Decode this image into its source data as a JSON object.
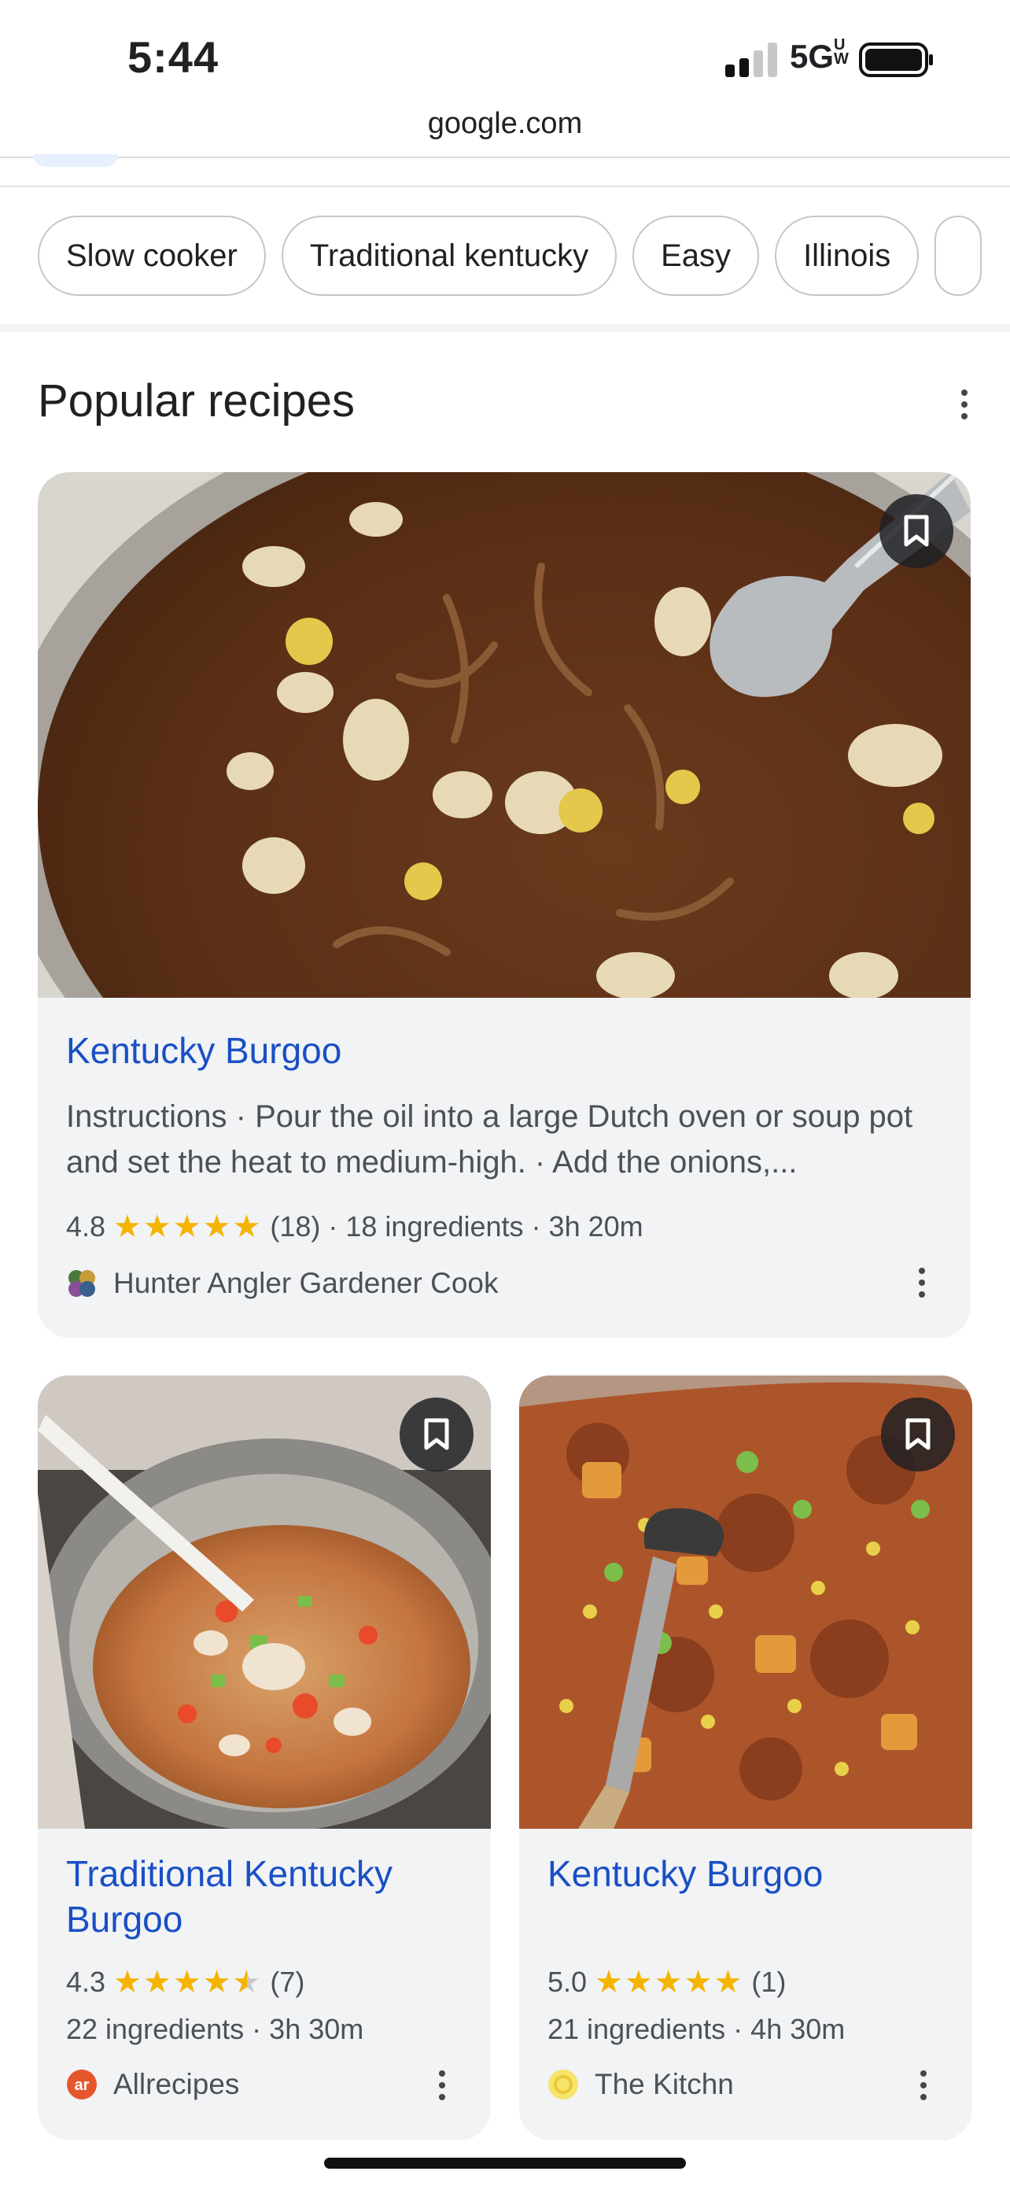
{
  "status_bar": {
    "time": "5:44",
    "network": "5G",
    "network_badge": "UW"
  },
  "browser": {
    "url": "google.com"
  },
  "filter_chips": [
    "Slow cooker",
    "Traditional kentucky",
    "Easy",
    "Illinois"
  ],
  "section": {
    "title": "Popular recipes"
  },
  "recipes": [
    {
      "title": "Kentucky Burgoo",
      "description": "Instructions · Pour the oil into a large Dutch oven or soup pot and set the heat to medium-high. · Add the onions,...",
      "rating": "4.8",
      "rating_value": 4.8,
      "reviews": "(18)",
      "ingredients": "18 ingredients",
      "time": "3h 20m",
      "source": "Hunter Angler Gardener Cook"
    },
    {
      "title": "Traditional Kentucky Burgoo",
      "rating": "4.3",
      "rating_value": 4.3,
      "reviews": "(7)",
      "ingredients": "22 ingredients",
      "time": "3h 30m",
      "source": "Allrecipes"
    },
    {
      "title": "Kentucky Burgoo",
      "rating": "5.0",
      "rating_value": 5.0,
      "reviews": "(1)",
      "ingredients": "21 ingredients",
      "time": "4h 30m",
      "source": "The Kitchn"
    }
  ],
  "colors": {
    "link": "#1a4fc5",
    "star": "#f4b400",
    "card_bg": "#f1f3f4"
  }
}
